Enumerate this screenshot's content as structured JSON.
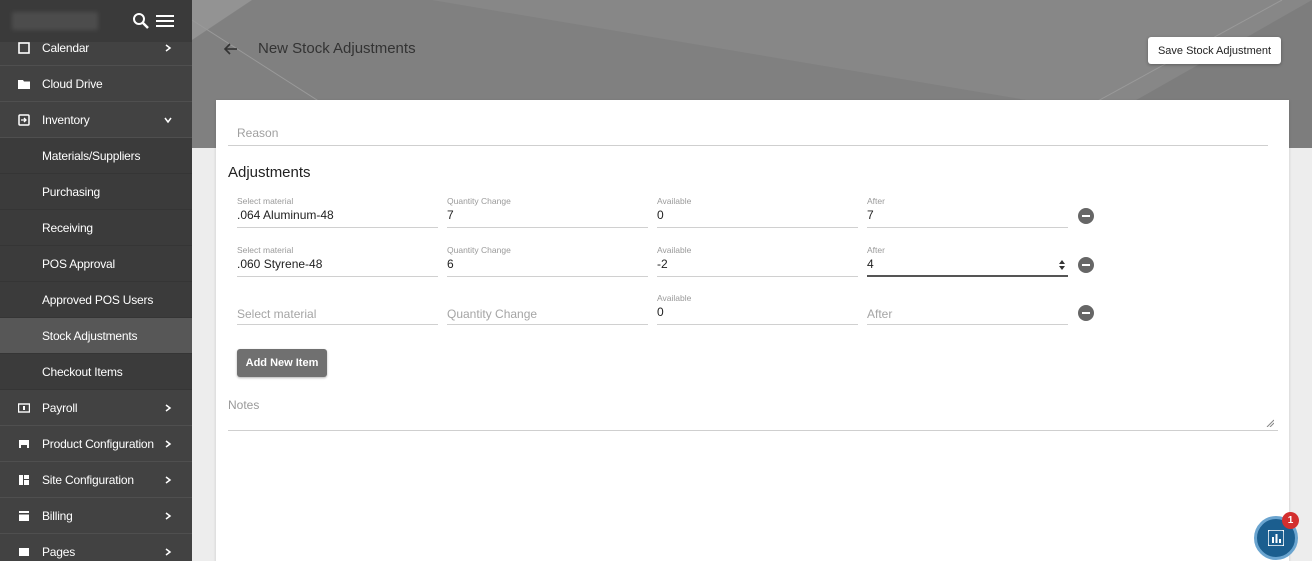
{
  "sidebar": {
    "items": [
      {
        "label": "Calendar",
        "icon": "calendar-icon",
        "chevron": "right"
      },
      {
        "label": "Cloud Drive",
        "icon": "folder-icon",
        "chevron": ""
      },
      {
        "label": "Inventory",
        "icon": "inventory-icon",
        "chevron": "down"
      },
      {
        "label": "Materials/Suppliers"
      },
      {
        "label": "Purchasing"
      },
      {
        "label": "Receiving"
      },
      {
        "label": "POS Approval"
      },
      {
        "label": "Approved POS Users"
      },
      {
        "label": "Stock Adjustments"
      },
      {
        "label": "Checkout Items"
      },
      {
        "label": "Payroll",
        "icon": "payroll-icon",
        "chevron": "right"
      },
      {
        "label": "Product Configuration",
        "icon": "product-config-icon",
        "chevron": "right"
      },
      {
        "label": "Site Configuration",
        "icon": "site-config-icon",
        "chevron": "right"
      },
      {
        "label": "Billing",
        "icon": "billing-icon",
        "chevron": "right"
      },
      {
        "label": "Pages",
        "icon": "pages-icon",
        "chevron": "right"
      }
    ]
  },
  "header": {
    "title": "New Stock Adjustments",
    "save_label": "Save Stock Adjustment"
  },
  "form": {
    "reason_placeholder": "Reason",
    "adjustments_title": "Adjustments",
    "rows": [
      {
        "material_label": "Select material",
        "material": ".064 Aluminum-48",
        "qty_label": "Quantity Change",
        "qty": "7",
        "avail_label": "Available",
        "available": "0",
        "after_label": "After",
        "after": "7"
      },
      {
        "material_label": "Select material",
        "material": ".060 Styrene-48",
        "qty_label": "Quantity Change",
        "qty": "6",
        "avail_label": "Available",
        "available": "-2",
        "after_label": "After",
        "after": "4"
      },
      {
        "material_placeholder": "Select material",
        "qty_placeholder": "Quantity Change",
        "avail_label": "Available",
        "available": "0",
        "after_placeholder": "After"
      }
    ],
    "add_item_label": "Add New Item",
    "notes_placeholder": "Notes"
  },
  "fab": {
    "badge": "1"
  },
  "colors": {
    "sidebar": "#424242",
    "header": "#878787",
    "accent": "#1b5e8f",
    "badge": "#d32f2f"
  }
}
